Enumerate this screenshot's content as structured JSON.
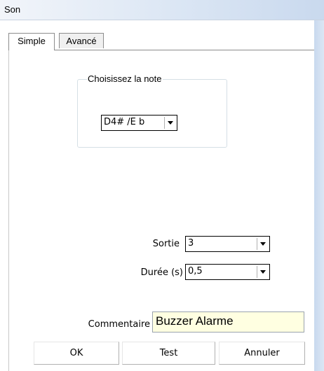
{
  "window": {
    "title": "Son"
  },
  "tabs": [
    {
      "label": "Simple",
      "active": true
    },
    {
      "label": "Avancé",
      "active": false
    }
  ],
  "note_group": {
    "legend": "Choisissez la note",
    "selected_note": "D4# /E b"
  },
  "sortie": {
    "label": "Sortie",
    "value": "3"
  },
  "duree": {
    "label": "Durée (s)",
    "value": "0,5"
  },
  "commentaire": {
    "label": "Commentaire",
    "value": "Buzzer Alarme"
  },
  "buttons": {
    "ok": "OK",
    "test": "Test",
    "annuler": "Annuler"
  },
  "colors": {
    "comment_bg": "#ffffe1",
    "titlebar": "#dbe6f4"
  }
}
